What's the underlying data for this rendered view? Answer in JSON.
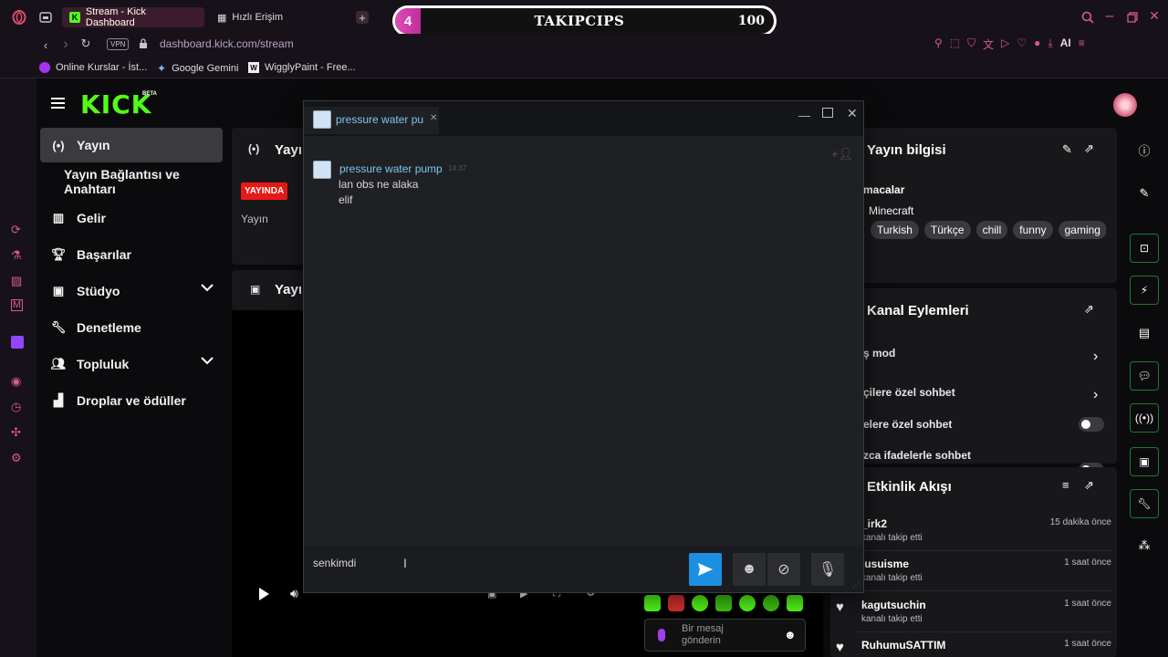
{
  "browser": {
    "tabs": [
      {
        "label": "Stream - Kick Dashboard"
      },
      {
        "label": "Hızlı Erişim"
      }
    ],
    "url": "dashboard.kick.com/stream",
    "vpn_label": "VPN",
    "ai_label": "AI",
    "bookmarks": [
      {
        "label": "Online Kurslar - İst..."
      },
      {
        "label": "Google Gemini"
      },
      {
        "label": "WigglyPaint - Free..."
      }
    ]
  },
  "overlay": {
    "count": "4",
    "title": "TAKIPCIPS",
    "goal": "100"
  },
  "kick": {
    "logo": "KICK",
    "beta": "BETA",
    "nav": [
      {
        "label": "Yayın",
        "icon": "broadcast-icon"
      },
      {
        "label": "Yayın Bağlantısı ve Anahtarı"
      },
      {
        "label": "Gelir",
        "icon": "chart-icon"
      },
      {
        "label": "Başarılar",
        "icon": "trophy-icon"
      },
      {
        "label": "Stüdyo",
        "icon": "studio-icon"
      },
      {
        "label": "Denetleme",
        "icon": "wrench-icon"
      },
      {
        "label": "Topluluk",
        "icon": "users-icon"
      },
      {
        "label": "Droplar ve ödüller",
        "icon": "drops-icon"
      }
    ],
    "stream_panel": {
      "title": "Yayı",
      "badge": "YAYINDA",
      "sub": "Yayın"
    },
    "video_panel": {
      "title": "Yayı"
    },
    "info_panel": {
      "title": "Yayın bilgisi",
      "category_label": "macalar",
      "category": "Minecraft",
      "tags": [
        "Turkish",
        "Türkçe",
        "chill",
        "funny",
        "gaming"
      ]
    },
    "actions_panel": {
      "title": "Kanal Eylemleri",
      "rows": [
        {
          "label": "ş mod"
        },
        {
          "label": "çilere özel sohbet"
        },
        {
          "label": "elere özel sohbet"
        },
        {
          "label": "zca ifadelerle sohbet"
        }
      ]
    },
    "feed_panel": {
      "title": "Etkinlik Akışı",
      "rows": [
        {
          "name": "_irk2",
          "sub": "kanalı takip etti",
          "time": "15 dakika önce"
        },
        {
          "name": "lusuisme",
          "sub": "kanalı takip etti",
          "time": "1 saat önce"
        },
        {
          "name": "kagutsuchin",
          "sub": "kanalı takip etti",
          "time": "1 saat önce"
        },
        {
          "name": "RuhumuSATTIM",
          "sub": "",
          "time": "1 saat önce"
        }
      ]
    },
    "chat_input_placeholder": "Bir mesaj gönderin"
  },
  "chatwin": {
    "tab_title": "pressure water pu",
    "messages": [
      {
        "user": "pressure water pump",
        "time": "14:37",
        "lines": [
          "lan obs ne alaka",
          "elif"
        ]
      }
    ],
    "input_value": "senkimdi"
  },
  "colors": {
    "kick_green": "#53fc18",
    "send_blue": "#1d8fe1",
    "live_red": "#e91916"
  }
}
